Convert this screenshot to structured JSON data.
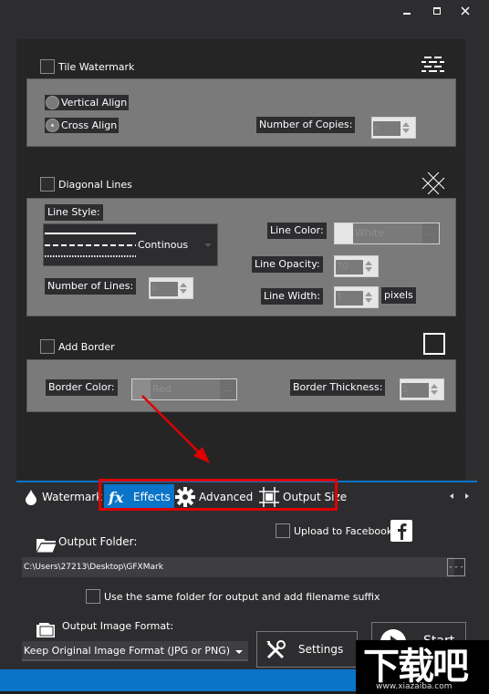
{
  "window": {
    "controls": [
      "minimize",
      "maximize",
      "close"
    ]
  },
  "tile_watermark": {
    "label": "Tile Watermark",
    "checked": false,
    "icon": "tile-pattern-icon",
    "vertical_align": "Vertical Align",
    "cross_align": "Cross Align",
    "selected_align": "Cross Align",
    "copies_label": "Number of Copies:",
    "copies_value": "6"
  },
  "diagonal_lines": {
    "label": "Diagonal Lines",
    "checked": false,
    "icon": "diagonal-cross-icon",
    "line_style_label": "Line Style:",
    "line_style_value": "Continous",
    "line_color_label": "Line Color:",
    "line_color_value": "White",
    "line_color_hex": "#e6e6e6",
    "line_opacity_label": "Line Opacity:",
    "line_opacity_value": "70",
    "line_width_label": "Line Width:",
    "line_width_value": "1",
    "line_width_unit": "pixels",
    "number_of_lines_label": "Number of Lines:",
    "number_of_lines_value": "6"
  },
  "add_border": {
    "label": "Add Border",
    "checked": false,
    "icon": "square-border-icon",
    "border_color_label": "Border Color:",
    "border_color_value": "Red",
    "border_color_hex": "#8c8c8c",
    "border_thickness_label": "Border Thickness:",
    "border_thickness_value": "5"
  },
  "tabs": [
    {
      "label": "Watermark",
      "icon": "water-drop-icon",
      "active": false
    },
    {
      "label": "Effects",
      "icon": "fx-icon",
      "active": true
    },
    {
      "label": "Advanced",
      "icon": "gear-icon",
      "active": false
    },
    {
      "label": "Output Size",
      "icon": "crop-icon",
      "active": false
    }
  ],
  "output": {
    "upload_facebook_label": "Upload to Facebook",
    "output_folder_label": "Output Folder:",
    "output_folder_path": "C:\\Users\\27213\\Desktop\\GFXMark",
    "browse_label": "- - -",
    "same_folder_label": "Use the same folder for output and add filename suffix",
    "format_label": "Output Image Format:",
    "format_value": "Keep Original Image Format (JPG or PNG)",
    "settings_label": "Settings",
    "start_label": "Start"
  },
  "watermark_overlay": {
    "brand": "下载吧",
    "url": "www.xiazaiba.com"
  },
  "colors": {
    "accent": "#0a74c9",
    "highlight": "#e00000",
    "background": "#2d2d30",
    "panel": "#252526",
    "group": "#7a7a7a"
  }
}
